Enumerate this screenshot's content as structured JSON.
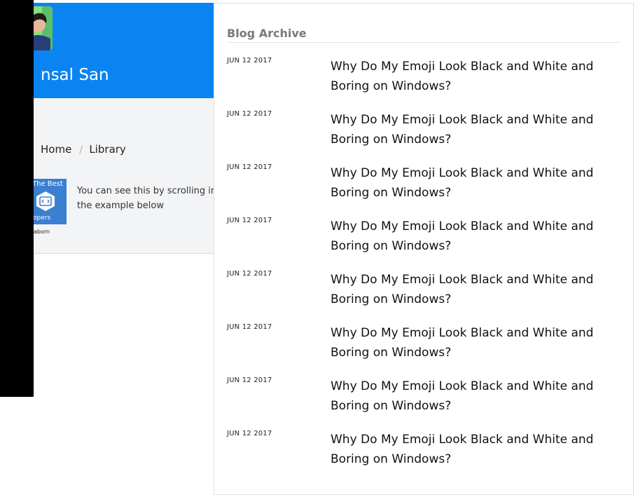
{
  "profile": {
    "name": "nsal San",
    "avatar_icon": "user-photo-icon",
    "header_color": "#0a84f0"
  },
  "breadcrumb": {
    "items": [
      "Home",
      "Library"
    ],
    "separator": "/"
  },
  "featured": {
    "thumb_top": "The Best",
    "thumb_bottom": "elopers",
    "thumb_icon": "code-hexagon-icon",
    "caption": "n caborn",
    "description": "You can see this by scrolling in\nthe example below"
  },
  "archive": {
    "heading": "Blog Archive",
    "posts": [
      {
        "date": "JUN 12 2017",
        "title": "Why Do My Emoji Look Black and White and Boring on Windows?"
      },
      {
        "date": "JUN 12 2017",
        "title": "Why Do My Emoji Look Black and White and Boring on Windows?"
      },
      {
        "date": "JUN 12 2017",
        "title": "Why Do My Emoji Look Black and White and Boring on Windows?"
      },
      {
        "date": "JUN 12 2017",
        "title": "Why Do My Emoji Look Black and White and Boring on Windows?"
      },
      {
        "date": "JUN 12 2017",
        "title": "Why Do My Emoji Look Black and White and Boring on Windows?"
      },
      {
        "date": "JUN 12 2017",
        "title": "Why Do My Emoji Look Black and White and Boring on Windows?"
      },
      {
        "date": "JUN 12 2017",
        "title": "Why Do My Emoji Look Black and White and Boring on Windows?"
      },
      {
        "date": "JUN 12 2017",
        "title": "Why Do My Emoji Look Black and White and Boring on Windows?"
      }
    ]
  }
}
